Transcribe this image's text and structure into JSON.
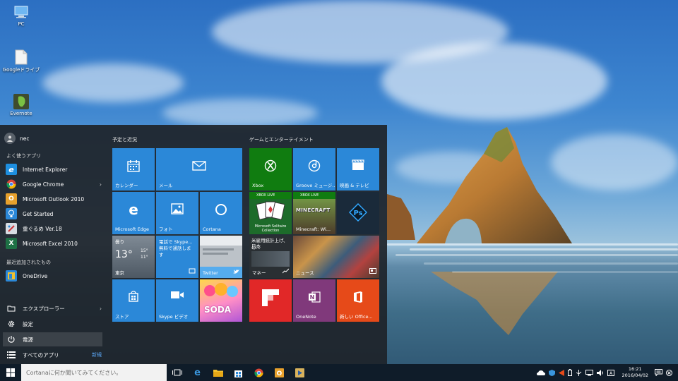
{
  "desktop": {
    "icons": [
      {
        "label": "PC"
      },
      {
        "label": "Googleドライブ"
      },
      {
        "label": "Evernote"
      }
    ]
  },
  "start_menu": {
    "user": {
      "name": "nec"
    },
    "frequent_label": "よく使うアプリ",
    "frequent_apps": [
      {
        "label": "Internet Explorer",
        "icon": "ie-icon"
      },
      {
        "label": "Google Chrome",
        "icon": "chrome-icon",
        "has_submenu": true
      },
      {
        "label": "Microsoft Outlook 2010",
        "icon": "outlook-icon"
      },
      {
        "label": "Get Started",
        "icon": "get-started-icon"
      },
      {
        "label": "重ぐるめ Ver.18",
        "icon": "app-icon"
      },
      {
        "label": "Microsoft Excel 2010",
        "icon": "excel-icon"
      }
    ],
    "recent_label": "最近追加されたもの",
    "recent_apps": [
      {
        "label": "OneDrive",
        "icon": "onedrive-icon"
      }
    ],
    "bottom": {
      "explorer": "エクスプローラー",
      "settings": "設定",
      "power": "電源",
      "all_apps": "すべてのアプリ",
      "new_badge": "新規"
    },
    "groups": {
      "left_title": "予定と近況",
      "right_title": "ゲームとエンターテイメント"
    },
    "tiles": {
      "calendar": "カレンダー",
      "mail": "メール",
      "edge": "Microsoft Edge",
      "photos": "フォト",
      "cortana": "Cortana",
      "weather": {
        "condition": "曇り",
        "temp": "13°",
        "high": "15°",
        "low": "11°",
        "city": "東京"
      },
      "skype_preview": {
        "line1": "電話で Skype...",
        "line2": "無料で通話しま",
        "line3": "す"
      },
      "twitter": "Twitter",
      "store": "ストア",
      "skype_video": "Skype ビデオ",
      "candy": "SODA",
      "xbox": "Xbox",
      "groove": "Groove ミュージ...",
      "movies": "映画 & テレビ",
      "xbox_live_badge": "XBOX LIVE",
      "solitaire": "Microsoft Solitaire Collection",
      "minecraft": "Minecraft: Wi...",
      "minecraft_logo": "MINECRAFT",
      "money": {
        "headline": "米雇用統計上げ、日本",
        "sub": "の...",
        "label": "マネー"
      },
      "news": "ニュース",
      "onenote": "OneNote",
      "office": "新しい Office..."
    }
  },
  "taskbar": {
    "search_placeholder": "Cortanaに何か聞いてみてください。",
    "time": "16:21",
    "date": "2016/04/02"
  },
  "colors": {
    "tile_blue": "#2b88d8",
    "xbox_green": "#107c10",
    "flipboard_red": "#e12828",
    "onenote_purple": "#80397b",
    "office_orange": "#e64a19",
    "taskbar": "#0f1c29"
  }
}
